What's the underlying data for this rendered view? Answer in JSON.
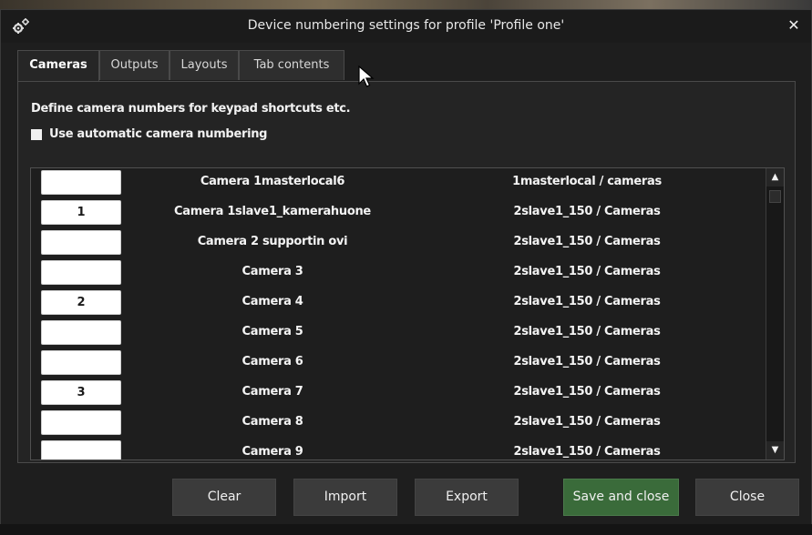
{
  "dialog": {
    "title": "Device numbering settings for profile 'Profile one'",
    "close_symbol": "✕",
    "icon": "gears-icon"
  },
  "tabs": [
    {
      "label": "Cameras",
      "active": true
    },
    {
      "label": "Outputs",
      "active": false
    },
    {
      "label": "Layouts",
      "active": false
    },
    {
      "label": "Tab contents",
      "active": false
    }
  ],
  "panel": {
    "description": "Define camera numbers for keypad shortcuts etc.",
    "auto_numbering_label": "Use automatic camera numbering",
    "auto_numbering_checked": false
  },
  "cameras": [
    {
      "number": "",
      "name": "Camera 1masterlocal6",
      "path": "1masterlocal / cameras"
    },
    {
      "number": "1",
      "name": "Camera 1slave1_kamerahuone",
      "path": "2slave1_150 / Cameras"
    },
    {
      "number": "",
      "name": "Camera 2 supportin ovi",
      "path": "2slave1_150 / Cameras"
    },
    {
      "number": "",
      "name": "Camera 3",
      "path": "2slave1_150 / Cameras"
    },
    {
      "number": "2",
      "name": "Camera 4",
      "path": "2slave1_150 / Cameras"
    },
    {
      "number": "",
      "name": "Camera 5",
      "path": "2slave1_150 / Cameras"
    },
    {
      "number": "",
      "name": "Camera 6",
      "path": "2slave1_150 / Cameras"
    },
    {
      "number": "3",
      "name": "Camera 7",
      "path": "2slave1_150 / Cameras"
    },
    {
      "number": "",
      "name": "Camera 8",
      "path": "2slave1_150 / Cameras"
    },
    {
      "number": "",
      "name": "Camera 9",
      "path": "2slave1_150 / Cameras"
    }
  ],
  "buttons": {
    "clear": "Clear",
    "import": "Import",
    "export": "Export",
    "save_and_close": "Save and close",
    "close": "Close"
  },
  "colors": {
    "primary_button": "#3a6b3a",
    "dialog_background": "#1e1e1e"
  }
}
